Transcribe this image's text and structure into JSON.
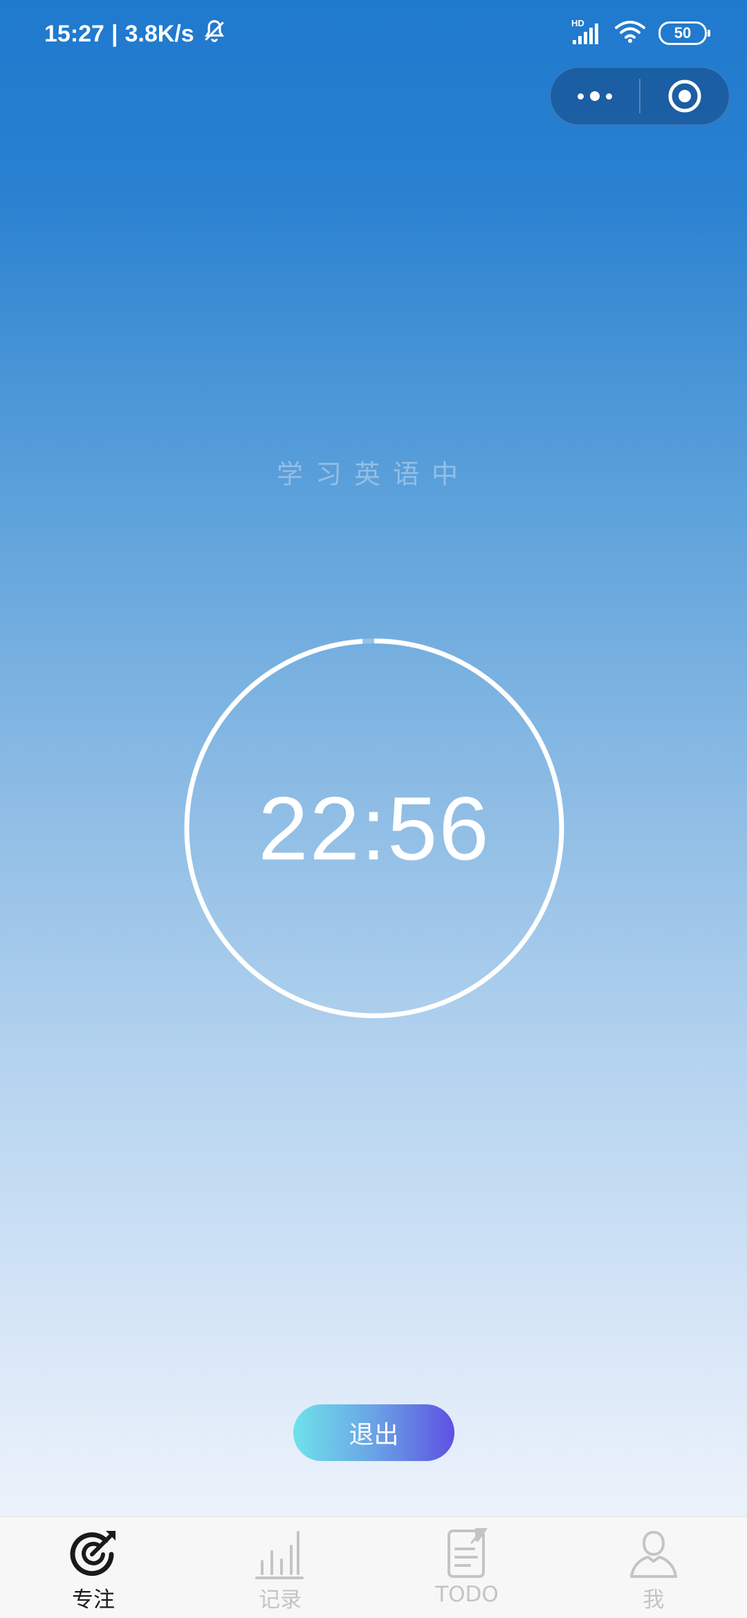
{
  "status_bar": {
    "time": "15:27",
    "separator": "|",
    "net_speed": "3.8K/s",
    "signal_label": "HD",
    "battery": "50",
    "icons": [
      "bell-muted-icon",
      "signal-icon",
      "wifi-icon",
      "battery-icon"
    ]
  },
  "capsule": {
    "icons": [
      "more-dots-icon",
      "close-target-icon"
    ]
  },
  "focus": {
    "task_label": "学习英语中",
    "timer": "22:56",
    "progress": 0.99
  },
  "actions": {
    "exit_label": "退出"
  },
  "tab_bar": {
    "items": [
      {
        "label": "专注",
        "icon": "focus-target-icon",
        "active": true
      },
      {
        "label": "记录",
        "icon": "bar-chart-icon",
        "active": false
      },
      {
        "label": "TODO",
        "icon": "note-pin-icon",
        "active": false
      },
      {
        "label": "我",
        "icon": "user-icon",
        "active": false
      }
    ]
  },
  "colors": {
    "gradient_top": "#1f79cd",
    "gradient_bottom": "#f6f9fd",
    "tab_active": "#1a1a1a",
    "tab_inactive": "#c4c4c4",
    "button_start": "#6ee2ea",
    "button_end": "#5d51e2"
  }
}
